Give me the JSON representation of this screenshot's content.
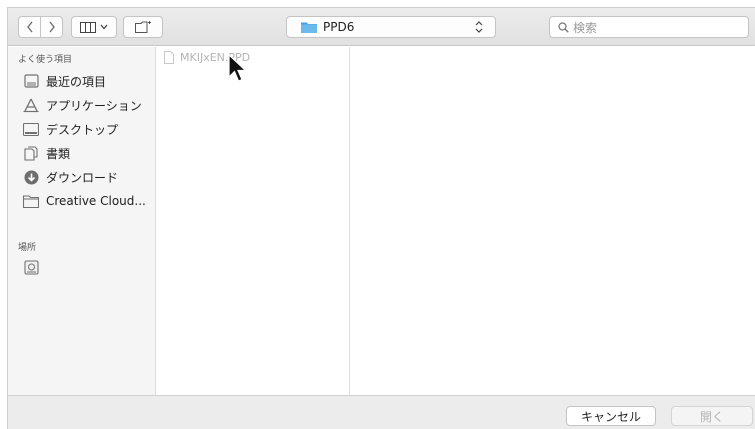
{
  "toolbar": {
    "back_icon": "chevron-left-icon",
    "forward_icon": "chevron-right-icon",
    "view_icon": "columns-view-icon",
    "new_folder_icon": "new-folder-icon",
    "path_label": "PPD6",
    "search_placeholder": "検索"
  },
  "sidebar": {
    "favorites_title": "よく使う項目",
    "items": [
      {
        "label": "最近の項目",
        "icon": "recents-icon"
      },
      {
        "label": "アプリケーション",
        "icon": "applications-icon"
      },
      {
        "label": "デスクトップ",
        "icon": "desktop-icon"
      },
      {
        "label": "書類",
        "icon": "documents-icon"
      },
      {
        "label": "ダウンロード",
        "icon": "downloads-icon"
      },
      {
        "label": "Creative Cloud...",
        "icon": "folder-icon"
      }
    ],
    "locations_title": "場所",
    "locations": [
      {
        "icon": "disk-icon"
      }
    ]
  },
  "files": [
    {
      "name": "MKIJxEN.PPD",
      "icon": "document-icon",
      "enabled": false
    }
  ],
  "bottom": {
    "cancel_label": "キャンセル",
    "open_label": "開く"
  },
  "colors": {
    "accent_folder": "#4aa3df",
    "disabled_text": "#b5b5b5"
  }
}
